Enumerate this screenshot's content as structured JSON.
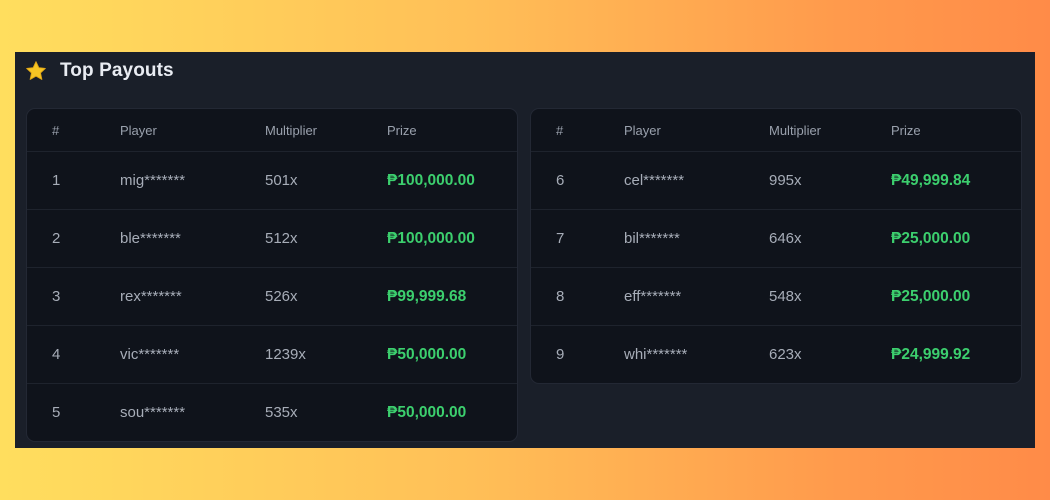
{
  "header": {
    "title": "Top Payouts",
    "icon": "star-icon",
    "icon_color": "#f7c524"
  },
  "columns": {
    "rank": "#",
    "player": "Player",
    "multiplier": "Multiplier",
    "prize": "Prize"
  },
  "colors": {
    "prize": "#3ccf6e",
    "panel_bg": "#1a1f29",
    "table_bg": "#0f131b"
  },
  "left_table": [
    {
      "rank": "1",
      "player": "mig*******",
      "multiplier": "501x",
      "prize": "₱100,000.00"
    },
    {
      "rank": "2",
      "player": "ble*******",
      "multiplier": "512x",
      "prize": "₱100,000.00"
    },
    {
      "rank": "3",
      "player": "rex*******",
      "multiplier": "526x",
      "prize": "₱99,999.68"
    },
    {
      "rank": "4",
      "player": "vic*******",
      "multiplier": "1239x",
      "prize": "₱50,000.00"
    },
    {
      "rank": "5",
      "player": "sou*******",
      "multiplier": "535x",
      "prize": "₱50,000.00"
    }
  ],
  "right_table": [
    {
      "rank": "6",
      "player": "cel*******",
      "multiplier": "995x",
      "prize": "₱49,999.84"
    },
    {
      "rank": "7",
      "player": "bil*******",
      "multiplier": "646x",
      "prize": "₱25,000.00"
    },
    {
      "rank": "8",
      "player": "eff*******",
      "multiplier": "548x",
      "prize": "₱25,000.00"
    },
    {
      "rank": "9",
      "player": "whi*******",
      "multiplier": "623x",
      "prize": "₱24,999.92"
    }
  ]
}
